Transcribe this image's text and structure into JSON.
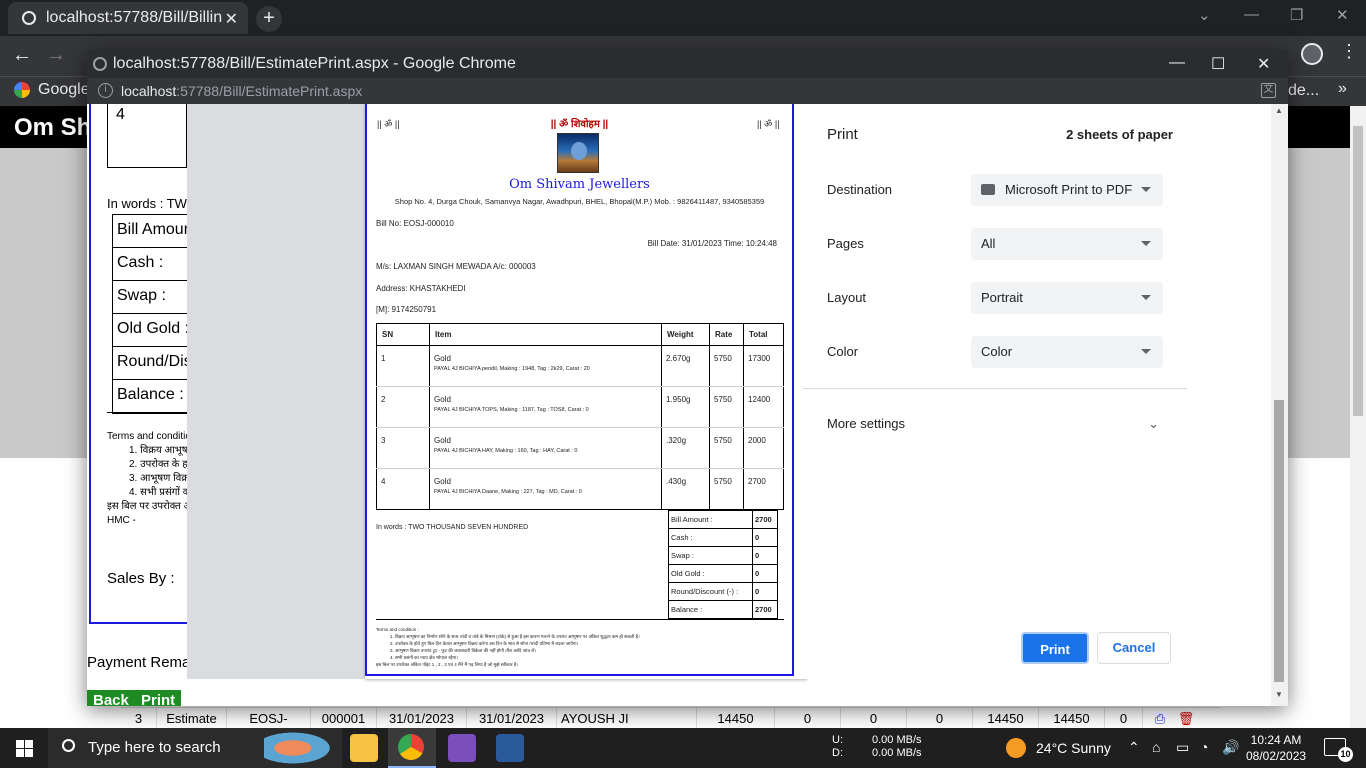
{
  "background": {
    "tab_title": "localhost:57788/Bill/Billin",
    "bookmark": "Google",
    "bookmark_right": "de...",
    "page_header": "Om Sh",
    "row": [
      "3",
      "Estimate",
      "EOSJ-",
      "000001",
      "31/01/2023",
      "31/01/2023",
      "AYOUSH JI",
      "14450",
      "0",
      "0",
      "0",
      "14450",
      "14450",
      "0"
    ]
  },
  "popup": {
    "title": "localhost:57788/Bill/EstimatePrint.aspx - Google Chrome",
    "url_host": "localhost",
    "url_path": ":57788/Bill/EstimatePrint.aspx"
  },
  "underlying": {
    "item_count": "4",
    "in_words": "In words : TW",
    "amounts": [
      "Bill Amour",
      "Cash :",
      "Swap :",
      "Old Gold :",
      "Round/Dis",
      "Balance :"
    ],
    "terms_title": "Terms and condition",
    "terms": [
      "1. विक्रय आभूषण",
      "2. उपरोक्त के ह",
      "3. आभूषण विक्र",
      "4. सभी प्रसंगों क"
    ],
    "terms_note": "इस बिल पर उपरोक्त अ",
    "hmc": "HMC -",
    "sales_by": "Sales By :",
    "payment": "Payment Rema",
    "back_btn": "Back",
    "print_btn": "Print"
  },
  "bill": {
    "om_left": "|| ॐ ||",
    "om_center": "|| ॐ शिवोहम ||",
    "om_right": "|| ॐ ||",
    "shop_name": "Om Shivam Jewellers",
    "address": "Shop No. 4, Durga Chouk, Samanvya Nagar, Awadhpuri, BHEL, Bhopal(M.P.) Mob. : 9826411487, 9340585359",
    "bill_no": "Bill No: EOSJ-000010",
    "bill_date": "Bill Date: 31/01/2023 Time: 10:24:48",
    "customer": "M/s: LAXMAN SINGH MEWADA A/c: 000003",
    "cust_address": "Address: KHASTAKHEDI",
    "mobile": "[M]: 9174250791",
    "columns": [
      "SN",
      "Item",
      "Weight",
      "Rate",
      "Total"
    ],
    "items": [
      {
        "sn": "1",
        "name": "Gold",
        "desc": "PAYAL 4J BICHIYA pendil, Making : 1948, Tag : 2k29, Carat : 20",
        "weight": "2.670g",
        "rate": "5750",
        "total": "17300"
      },
      {
        "sn": "2",
        "name": "Gold",
        "desc": "PAYAL 4J BICHIYA TOPS, Making : 1187, Tag : TOS8, Carat : 0",
        "weight": "1.950g",
        "rate": "5750",
        "total": "12400"
      },
      {
        "sn": "3",
        "name": "Gold",
        "desc": "PAYAL 4J BICHIYA HAY, Making : 160, Tag : HAY, Carat : 0",
        "weight": ".320g",
        "rate": "5750",
        "total": "2000"
      },
      {
        "sn": "4",
        "name": "Gold",
        "desc": "PAYAL 4J BICHIYA Daane, Making : 227, Tag : MD, Carat : 0",
        "weight": ".430g",
        "rate": "5750",
        "total": "2700"
      }
    ],
    "in_words": "In words : TWO THOUSAND SEVEN HUNDRED",
    "amounts": [
      {
        "label": "Bill Amount :",
        "value": "2700"
      },
      {
        "label": "Cash :",
        "value": "0"
      },
      {
        "label": "Swap :",
        "value": "0"
      },
      {
        "label": "Old Gold :",
        "value": "0"
      },
      {
        "label": "Round/Discount (-) :",
        "value": "0"
      },
      {
        "label": "Balance :",
        "value": "2700"
      }
    ],
    "terms_title": "Terms and condition :",
    "terms": [
      "1. विक्रय आभूषण का निर्माण सोने के साथ चांदी व तांबे के मिश्रण (टांके) से हुआ है इस कारण गलाने के उपरांत आभूषण पर अंकित शुद्धता कम हो सकती है।",
      "2. उपरोक्त के होते हुए बिल दिन केवल आभूषण विक्रय करेगा उस दिन के भाव से सोना /चांदी प्रतिभा में बदला जायेगा।",
      "3. आभूषण विक्रय उपरांत टूट - फूट की जवाबदारी विक्रेता की नहीं होगी तौल आदि जांच लें।",
      "4. सभी प्रसंगों का न्याय क्षेत्र भोपाल रहेगा।"
    ],
    "terms_note": "इस बिल पर उपरोक्त अंकित पॉइंट 1 , 2 , 3 एवं 4 मैंने मैं पढ़ लिया है जो मुझे स्वीकार है।"
  },
  "print_panel": {
    "title": "Print",
    "sheets": "2 sheets of paper",
    "destination_label": "Destination",
    "destination_value": "Microsoft Print to PDF",
    "pages_label": "Pages",
    "pages_value": "All",
    "layout_label": "Layout",
    "layout_value": "Portrait",
    "color_label": "Color",
    "color_value": "Color",
    "more_settings": "More settings",
    "print_button": "Print",
    "cancel_button": "Cancel"
  },
  "taskbar": {
    "search_placeholder": "Type here to search",
    "net_up_label": "U:",
    "net_down_label": "D:",
    "net_up": "0.00 MB/s",
    "net_down": "0.00 MB/s",
    "weather": "24°C  Sunny",
    "time": "10:24 AM",
    "date": "08/02/2023",
    "notifications": "10"
  },
  "colors": {
    "accent_blue": "#1a73e8",
    "bill_border": "#1a1ae0",
    "green_button": "#1e8b24"
  }
}
